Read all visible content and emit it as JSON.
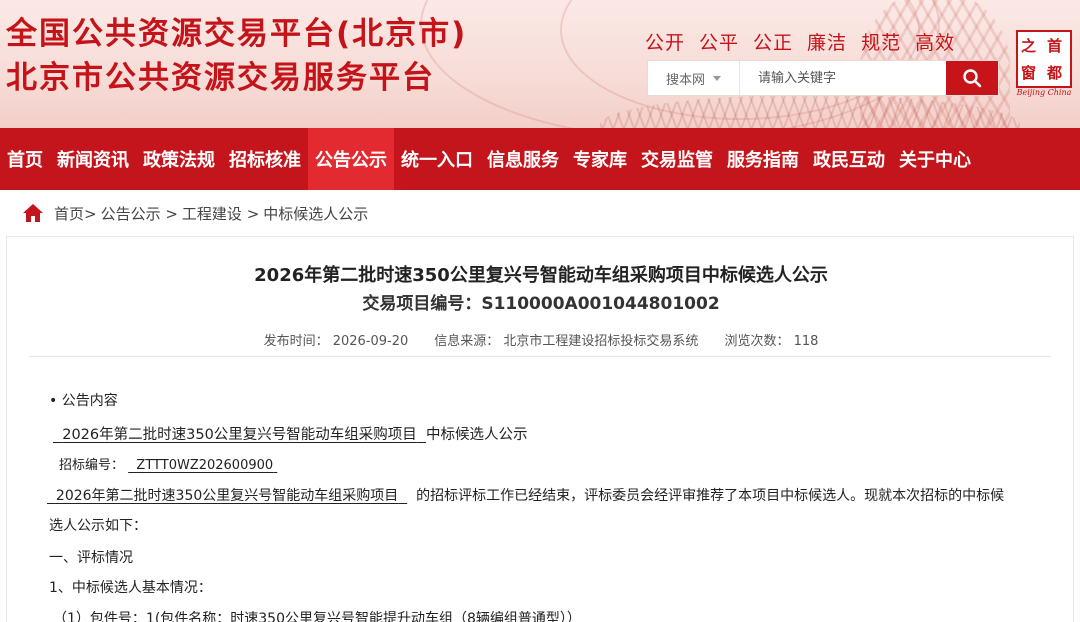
{
  "header": {
    "title_line1": "全国公共资源交易平台(北京市)",
    "title_line2": "北京市公共资源交易服务平台",
    "slogans": [
      "公开",
      "公平",
      "公正",
      "廉洁",
      "规范",
      "高效"
    ],
    "logo": {
      "chars": [
        "之",
        "首",
        "窗",
        "都"
      ],
      "en": "Beijing China"
    },
    "search": {
      "scope": "搜本网",
      "placeholder": "请输入关键字"
    }
  },
  "nav": {
    "items": [
      "首页",
      "新闻资讯",
      "政策法规",
      "招标核准",
      "公告公示",
      "统一入口",
      "信息服务",
      "专家库",
      "交易监管",
      "服务指南",
      "政民互动",
      "关于中心"
    ],
    "active_index": 4
  },
  "breadcrumb": {
    "items": [
      "首页>",
      "公告公示 >",
      "工程建设 >",
      "中标候选人公示"
    ]
  },
  "article": {
    "title": "2026年第二批时速350公里复兴号智能动车组采购项目中标候选人公示",
    "subtitle": "交易项目编号：S110000A001044801002",
    "meta": {
      "published": "发布时间：  2026-09-20",
      "source": "信息来源：  北京市工程建设招标投标交易系统",
      "views": "浏览次数：  118"
    },
    "section_label": "• 公告内容",
    "line_title_project": "2026年第二批时速350公里复兴号智能动车组采购项目",
    "line_title_suffix": "中标候选人公示",
    "bid_no_label": "招标编号：",
    "bid_no_value": "ZTTT0WZ202600900",
    "para_project": "2026年第二批时速350公里复兴号智能动车组采购项目",
    "para_rest": "的招标评标工作已经结束，评标委员会经评审推荐了本项目中标候选人。现就本次招标的中标候",
    "para_line2": "选人公示如下：",
    "sec1": "一、评标情况",
    "sec1_1": "1、中标候选人基本情况：",
    "pkg": "（1）包件号：1(包件名称：时速350公里复兴号智能提升动车组（8辆编组普通型））"
  },
  "colors": {
    "brand_red": "#c4151c",
    "nav_active": "#e42a31",
    "header_bg": "#f7dcd7"
  }
}
